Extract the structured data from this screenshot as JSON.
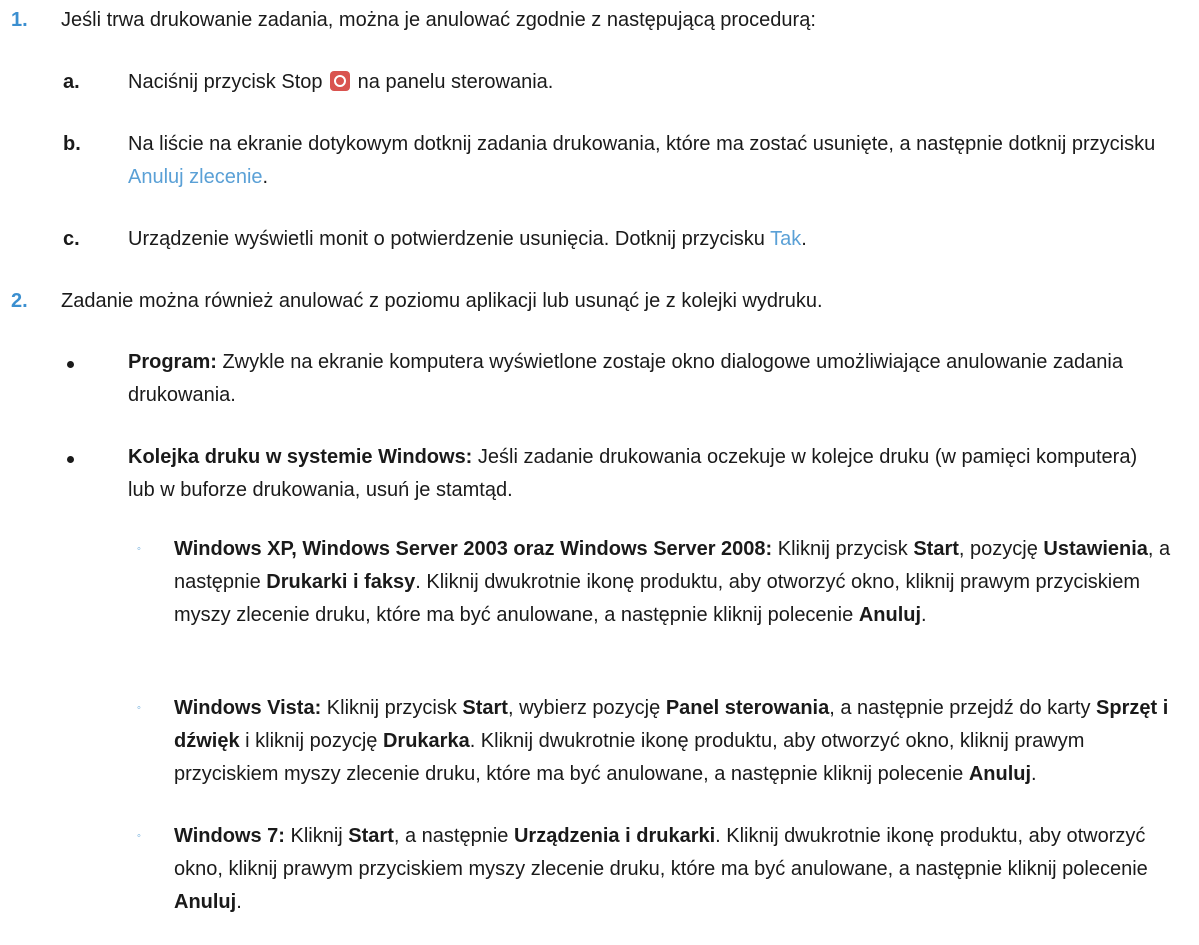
{
  "step1": {
    "num": "1.",
    "text": "Jeśli trwa drukowanie zadania, można je anulować zgodnie z następującą procedurą:",
    "a": {
      "ltr": "a.",
      "before": "Naciśnij przycisk Stop",
      "after": "na panelu sterowania.",
      "icon": "stop-icon"
    },
    "b": {
      "ltr": "b.",
      "text": "Na liście na ekranie dotykowym dotknij zadania drukowania, które ma zostać usunięte, a następnie dotknij przycisku",
      "link": "Anuluj zlecenie",
      "end": "."
    },
    "c": {
      "ltr": "c.",
      "text": "Urządzenie wyświetli monit o potwierdzenie usunięcia. Dotknij przycisku",
      "link": "Tak",
      "end": "."
    }
  },
  "step2": {
    "num": "2.",
    "text": "Zadanie można również anulować z poziomu aplikacji lub usunąć je z kolejki wydruku.",
    "bullet1": {
      "bold": "Program:",
      "text": " Zwykle na ekranie komputera wyświetlone zostaje okno dialogowe umożliwiające anulowanie zadania drukowania."
    },
    "bullet2": {
      "bold": "Kolejka druku w systemie Windows:",
      "text": " Jeśli zadanie drukowania oczekuje w kolejce druku (w pamięci komputera) lub w buforze drukowania, usuń je stamtąd."
    },
    "sub1": {
      "bold": "Windows XP, Windows Server 2003 oraz Windows Server 2008:",
      "t1": " Kliknij przycisk ",
      "b1": "Start",
      "t2": ", pozycję ",
      "b2": "Ustawienia",
      "t3": ", a następnie ",
      "b3": "Drukarki i faksy",
      "t4": ". Kliknij dwukrotnie ikonę produktu, aby otworzyć okno, kliknij prawym przyciskiem myszy zlecenie druku, które ma być anulowane, a następnie kliknij polecenie ",
      "b4": "Anuluj",
      "t5": "."
    },
    "sub2": {
      "bold": "Windows Vista:",
      "t1": " Kliknij przycisk ",
      "b1": "Start",
      "t2": ", wybierz pozycję ",
      "b2": "Panel sterowania",
      "t3": ", a następnie przejdź do karty ",
      "b3": "Sprzęt i dźwięk",
      "t4": " i kliknij pozycję ",
      "b4": "Drukarka",
      "t5": ". Kliknij dwukrotnie ikonę produktu, aby otworzyć okno, kliknij prawym przyciskiem myszy zlecenie druku, które ma być anulowane, a następnie kliknij polecenie ",
      "b5": "Anuluj",
      "t6": "."
    },
    "sub3": {
      "bold": "Windows 7:",
      "t1": " Kliknij ",
      "b1": "Start",
      "t2": ", a następnie ",
      "b2": "Urządzenia i drukarki",
      "t3": ". Kliknij dwukrotnie ikonę produktu, aby otworzyć okno, kliknij prawym przyciskiem myszy zlecenie druku, które ma być anulowane, a następnie kliknij polecenie ",
      "b3": "Anuluj",
      "t4": "."
    },
    "sub_marker": "◦"
  }
}
